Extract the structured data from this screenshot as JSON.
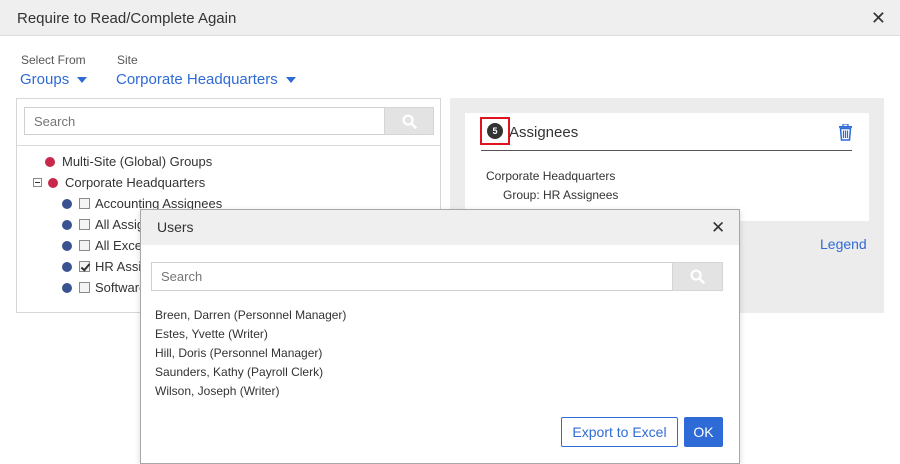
{
  "dialog": {
    "title": "Require to Read/Complete Again",
    "close_icon": "close-icon"
  },
  "select_from": {
    "label": "Select From",
    "value": "Groups"
  },
  "site": {
    "label": "Site",
    "value": "Corporate Headquarters"
  },
  "left_panel": {
    "search_placeholder": "Search",
    "tree": [
      {
        "label": "Multi-Site (Global) Groups",
        "dot_color": "#c8284a"
      },
      {
        "label": "Corporate Headquarters",
        "dot_color": "#c8284a",
        "expanded": true
      },
      {
        "label": "Accounting Assignees",
        "dot_color": "#3a5290",
        "checked": false
      },
      {
        "label": "All Assig",
        "dot_color": "#3a5290",
        "checked": false
      },
      {
        "label": "All Excep",
        "dot_color": "#3a5290",
        "checked": false
      },
      {
        "label": "HR Assig",
        "dot_color": "#3a5290",
        "checked": true
      },
      {
        "label": "Software",
        "dot_color": "#3a5290",
        "checked": false
      }
    ]
  },
  "assignees_card": {
    "count": "5",
    "title": "Assignees",
    "site": "Corporate Headquarters",
    "group": "Group: HR Assignees",
    "delete_icon": "trash-icon"
  },
  "legend_label": "Legend",
  "users_dialog": {
    "title": "Users",
    "search_placeholder": "Search",
    "users": [
      "Breen, Darren (Personnel Manager)",
      "Estes, Yvette (Writer)",
      "Hill, Doris (Personnel Manager)",
      "Saunders, Kathy (Payroll Clerk)",
      "Wilson, Joseph (Writer)"
    ],
    "export_label": "Export to Excel",
    "ok_label": "OK"
  },
  "colors": {
    "accent": "#2f6bd6",
    "highlight": "#e0141e",
    "global_group_dot": "#c8284a",
    "group_dot": "#3a5290"
  }
}
